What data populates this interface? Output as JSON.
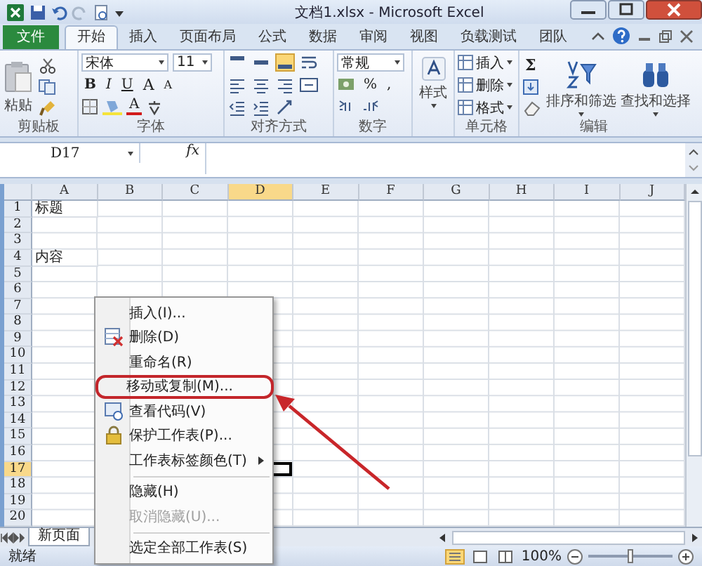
{
  "window": {
    "title": "文档1.xlsx - Microsoft Excel"
  },
  "tabs": [
    {
      "label": "文件",
      "kind": "file",
      "selected": false
    },
    {
      "label": "开始",
      "kind": "tab",
      "selected": true
    },
    {
      "label": "插入",
      "kind": "tab",
      "selected": false
    },
    {
      "label": "页面布局",
      "kind": "tab",
      "selected": false
    },
    {
      "label": "公式",
      "kind": "tab",
      "selected": false
    },
    {
      "label": "数据",
      "kind": "tab",
      "selected": false
    },
    {
      "label": "审阅",
      "kind": "tab",
      "selected": false
    },
    {
      "label": "视图",
      "kind": "tab",
      "selected": false
    },
    {
      "label": "负载测试",
      "kind": "tab",
      "selected": false
    },
    {
      "label": "团队",
      "kind": "tab",
      "selected": false
    }
  ],
  "ribbon": {
    "clipboard": {
      "paste": "粘贴",
      "label": "剪贴板"
    },
    "font": {
      "name": "宋体",
      "size": "11",
      "style_buttons": [
        "B",
        "I",
        "U"
      ],
      "size_buttons": [
        "A",
        "A"
      ],
      "color_button": "A",
      "label": "字体"
    },
    "alignment": {
      "vertical": [
        {
          "selected": false
        },
        {
          "selected": false
        },
        {
          "selected": true
        }
      ],
      "label": "对齐方式"
    },
    "number": {
      "format": "常规",
      "symbols": [
        "%",
        ","
      ],
      "label": "数字"
    },
    "styles": {
      "button": "样式"
    },
    "cells": {
      "buttons": [
        "插入",
        "删除",
        "格式"
      ],
      "label": "单元格"
    },
    "editing": {
      "sum": "Σ",
      "buttons": [
        "排序和筛选",
        "查找和选择"
      ],
      "label": "编辑"
    }
  },
  "formula_bar": {
    "name_box": "D17",
    "function_label": "fx"
  },
  "sheet": {
    "columns": [
      {
        "label": "A",
        "selected": false
      },
      {
        "label": "B",
        "selected": false
      },
      {
        "label": "C",
        "selected": false
      },
      {
        "label": "D",
        "selected": true
      },
      {
        "label": "E",
        "selected": false
      },
      {
        "label": "F",
        "selected": false
      },
      {
        "label": "G",
        "selected": false
      },
      {
        "label": "H",
        "selected": false
      },
      {
        "label": "I",
        "selected": false
      },
      {
        "label": "J",
        "selected": false
      }
    ],
    "rows": [
      {
        "number": "1",
        "column_a": "标题",
        "selected": false
      },
      {
        "number": "2",
        "selected": false
      },
      {
        "number": "3",
        "selected": false
      },
      {
        "number": "4",
        "column_a": "内容",
        "selected": false
      },
      {
        "number": "5",
        "selected": false
      },
      {
        "number": "6",
        "selected": false
      },
      {
        "number": "7",
        "selected": false
      },
      {
        "number": "8",
        "selected": false
      },
      {
        "number": "9",
        "selected": false
      },
      {
        "number": "10",
        "selected": false
      },
      {
        "number": "11",
        "selected": false
      },
      {
        "number": "12",
        "selected": false
      },
      {
        "number": "13",
        "selected": false
      },
      {
        "number": "14",
        "selected": false
      },
      {
        "number": "15",
        "selected": false
      },
      {
        "number": "16",
        "selected": false
      },
      {
        "number": "17",
        "selected": true
      },
      {
        "number": "18",
        "selected": false
      },
      {
        "number": "19",
        "selected": false
      },
      {
        "number": "20",
        "selected": false
      }
    ]
  },
  "sheet_tabs": [
    {
      "label": "新页面",
      "selected": true
    }
  ],
  "context_menu": {
    "items": [
      {
        "kind": "plain",
        "label": "插入(I)...",
        "disabled": false,
        "highlighted": false
      },
      {
        "kind": "delete",
        "label": "删除(D)",
        "disabled": false,
        "highlighted": false
      },
      {
        "kind": "plain",
        "label": "重命名(R)",
        "disabled": false,
        "highlighted": false
      },
      {
        "kind": "plain",
        "label": "移动或复制(M)...",
        "disabled": false,
        "highlighted": true
      },
      {
        "kind": "code",
        "label": "查看代码(V)",
        "disabled": false,
        "highlighted": false
      },
      {
        "kind": "protect",
        "label": "保护工作表(P)...",
        "disabled": false,
        "highlighted": false
      },
      {
        "kind": "submenu",
        "label": "工作表标签颜色(T)",
        "disabled": false,
        "highlighted": false
      },
      {
        "kind": "separator"
      },
      {
        "kind": "plain",
        "label": "隐藏(H)",
        "disabled": false,
        "highlighted": false
      },
      {
        "kind": "plain",
        "label": "取消隐藏(U)...",
        "disabled": true,
        "highlighted": false
      },
      {
        "kind": "separator"
      },
      {
        "kind": "plain",
        "label": "选定全部工作表(S)",
        "disabled": false,
        "highlighted": false
      }
    ]
  },
  "status_bar": {
    "text": "就绪",
    "zoom": "100%",
    "zoom_slider": {
      "level": 0.5
    }
  }
}
